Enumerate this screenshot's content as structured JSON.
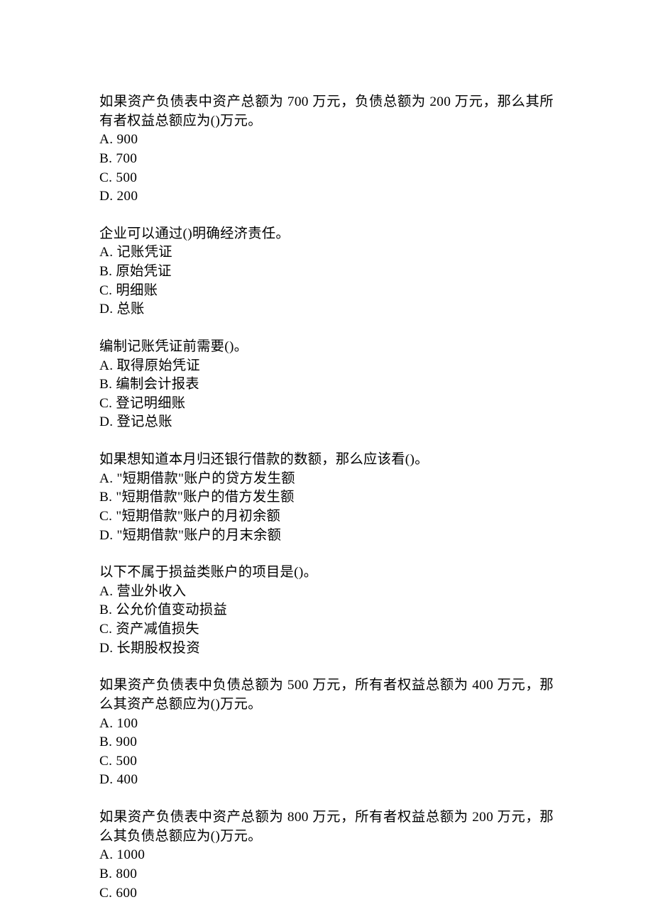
{
  "questions": [
    {
      "stem": "如果资产负债表中资产总额为 700 万元，负债总额为 200 万元，那么其所有者权益总额应为()万元。",
      "options": [
        "A. 900",
        "B. 700",
        "C. 500",
        "D. 200"
      ]
    },
    {
      "stem": "企业可以通过()明确经济责任。",
      "options": [
        "A. 记账凭证",
        "B. 原始凭证",
        "C. 明细账",
        "D. 总账"
      ]
    },
    {
      "stem": "编制记账凭证前需要()。",
      "options": [
        "A. 取得原始凭证",
        "B. 编制会计报表",
        "C. 登记明细账",
        "D. 登记总账"
      ]
    },
    {
      "stem": "如果想知道本月归还银行借款的数额，那么应该看()。",
      "options": [
        "A. \"短期借款\"账户的贷方发生额",
        "B. \"短期借款\"账户的借方发生额",
        "C. \"短期借款\"账户的月初余额",
        "D. \"短期借款\"账户的月末余额"
      ]
    },
    {
      "stem": "以下不属于损益类账户的项目是()。",
      "options": [
        "A. 营业外收入",
        "B. 公允价值变动损益",
        "C. 资产减值损失",
        "D. 长期股权投资"
      ]
    },
    {
      "stem": "如果资产负债表中负债总额为 500 万元，所有者权益总额为 400 万元，那么其资产总额应为()万元。",
      "options": [
        "A. 100",
        "B. 900",
        "C. 500",
        "D. 400"
      ]
    },
    {
      "stem": "如果资产负债表中资产总额为 800 万元，所有者权益总额为 200 万元，那么其负债总额应为()万元。",
      "options": [
        "A. 1000",
        "B. 800",
        "C. 600"
      ]
    }
  ]
}
